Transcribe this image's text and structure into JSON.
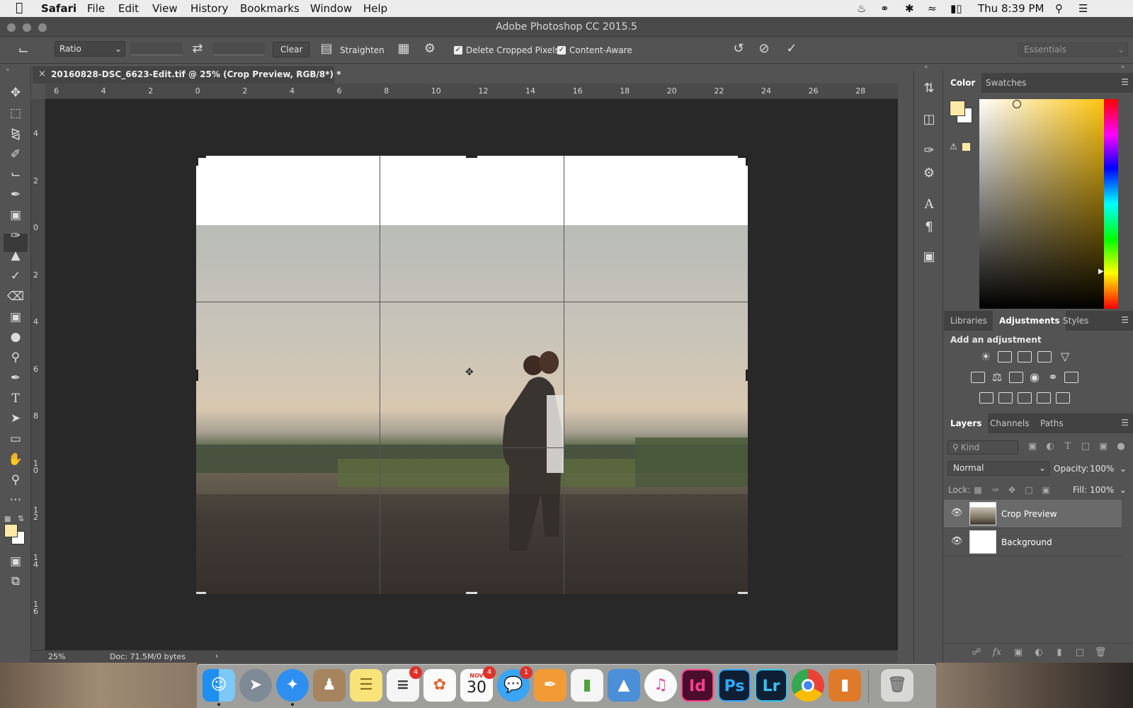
{
  "menubar": {
    "apple": "",
    "app": "Safari",
    "items": [
      "File",
      "Edit",
      "View",
      "History",
      "Bookmarks",
      "Window",
      "Help"
    ],
    "clock": "Thu 8:39 PM"
  },
  "window": {
    "title": "Adobe Photoshop CC 2015.5"
  },
  "options": {
    "ratio": "Ratio",
    "clear": "Clear",
    "straighten": "Straighten",
    "delete_cropped": "Delete Cropped Pixels",
    "content_aware": "Content-Aware",
    "workspace": "Essentials"
  },
  "document": {
    "tab": "20160828-DSC_6623-Edit.tif @ 25% (Crop Preview, RGB/8*) *",
    "close": "×"
  },
  "ruler": {
    "h": [
      "6",
      "4",
      "2",
      "0",
      "2",
      "4",
      "6",
      "8",
      "10",
      "12",
      "14",
      "16",
      "18",
      "20",
      "22",
      "24",
      "26",
      "28"
    ],
    "v": [
      "4",
      "2",
      "0",
      "2",
      "4",
      "6",
      "8",
      "1\n0",
      "1\n2",
      "1\n4",
      "1\n6"
    ]
  },
  "status": {
    "zoom": "25%",
    "doc": "Doc: 71.5M/0 bytes",
    "arrow": "›"
  },
  "color_panel": {
    "tabs": [
      "Color",
      "Swatches"
    ],
    "fg": "#fde9a6",
    "bg": "#ffffff"
  },
  "adjustments_panel": {
    "tabs": [
      "Libraries",
      "Adjustments",
      "Styles"
    ],
    "heading": "Add an adjustment"
  },
  "layers_panel": {
    "tabs": [
      "Layers",
      "Channels",
      "Paths"
    ],
    "kind": "Kind",
    "blend": "Normal",
    "opacity_label": "Opacity:",
    "opacity": "100%",
    "lock_label": "Lock:",
    "fill_label": "Fill:",
    "fill": "100%",
    "layers": [
      {
        "name": "Crop Preview",
        "selected": true
      },
      {
        "name": "Background",
        "selected": false
      }
    ]
  },
  "dock": {
    "badges": {
      "reminders": "4",
      "calendar": "4",
      "messages": "1"
    },
    "calendar_month": "NOV",
    "calendar_day": "30",
    "apps": [
      "Finder",
      "Launchpad",
      "Safari",
      "Contacts",
      "Notes",
      "Reminders",
      "Photos",
      "Calendar",
      "Messages",
      "Pages",
      "Numbers",
      "Keynote",
      "iTunes",
      "Id",
      "Ps",
      "Lr",
      "Chrome",
      "Pocket",
      "Trash"
    ]
  }
}
